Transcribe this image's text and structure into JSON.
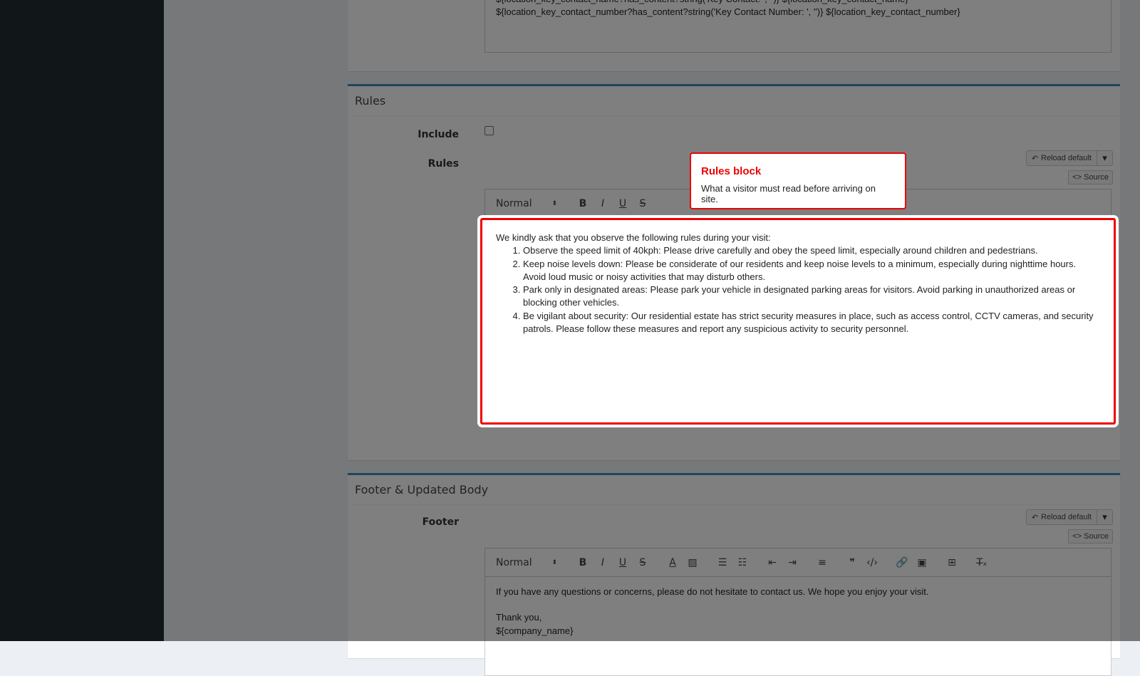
{
  "top_section": {
    "template_lines": [
      "${location_key_contact_name?has_content?string('Key Contact: ', '')} ${location_key_contact_name}",
      "${location_key_contact_number?has_content?string('Key Contact Number: ', '')} ${location_key_contact_number}"
    ]
  },
  "rules_section": {
    "title": "Rules",
    "include_label": "Include",
    "include_checked": false,
    "rules_label": "Rules",
    "reload_label": "Reload default",
    "source_label": "<> Source",
    "toolbar_format": "Normal",
    "intro": "We kindly ask that you observe the following rules during your visit:",
    "items": [
      "Observe the speed limit of 40kph: Please drive carefully and obey the speed limit, especially around children and pedestrians.",
      "Keep noise levels down: Please be considerate of our residents and keep noise levels to a minimum, especially during nighttime hours. Avoid loud music or noisy activities that may disturb others.",
      "Park only in designated areas: Please park your vehicle in designated parking areas for visitors. Avoid parking in unauthorized areas or blocking other vehicles.",
      "Be vigilant about security: Our residential estate has strict security measures in place, such as access control, CCTV cameras, and security patrols. Please follow these measures and report any suspicious activity to security personnel."
    ]
  },
  "tooltip": {
    "title": "Rules block",
    "text": "What a visitor must read before arriving on site."
  },
  "footer_section": {
    "title": "Footer & Updated Body",
    "footer_label": "Footer",
    "reload_label": "Reload default",
    "source_label": "<> Source",
    "toolbar_format": "Normal",
    "line1": "If you have any questions or concerns, please do not hesitate to contact us. We hope you enjoy your visit.",
    "line2": "Thank you,",
    "line3": "${company_name}"
  },
  "colors": {
    "accent": "#3c8dbc",
    "highlight": "#e00000",
    "sidebar": "#222d32"
  }
}
